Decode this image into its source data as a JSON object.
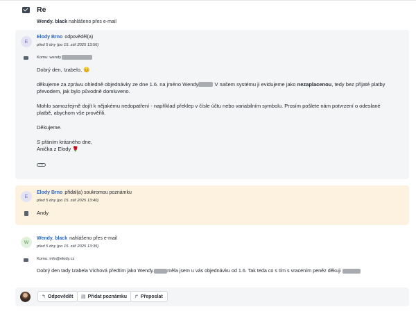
{
  "header": {
    "title": "Re",
    "icon": "envelope-icon"
  },
  "reported_line": {
    "sender": "Wendy. black",
    "text": "nahlášeno přes e-mail"
  },
  "messages": [
    {
      "author": "Elody Brno",
      "action": "odpověděl(a)",
      "time": "před 5 dny (po 15. zář 2025 13:56)",
      "avatar_letter": "E",
      "to_label": "Komu: wendy",
      "greeting": "Dobrý den, Izabelo, 😊",
      "p1_a": "děkujeme za zprávu ohledně objednávky ze dne 1.6. na jméno Wendy",
      "p1_b": " V našem systému ji evidujeme jako ",
      "p1_bold": "nezaplacenou",
      "p1_c": ", tedy bez přijaté platby převodem, jak bylo původně domluveno.",
      "p2": "Mohlo samozřejmě dojít k nějakému nedopatření - například překlep v čísle účtu nebo variabilním symbolu. Prosím pošlete nám potvrzení o odeslané platbě, abychom vše prověřili.",
      "thanks": "Děkujeme.",
      "closing": "S přáním krásného dne,",
      "signature": "Anička z Elody 🌹"
    },
    {
      "author": "Elody Brno",
      "action": "přidal(a) soukromou poznámku",
      "time": "před 5 dny (po 15. zář 2025 13:40)",
      "avatar_letter": "E",
      "note": "Andy"
    },
    {
      "author": "Wendy. black",
      "action": "nahlášeno přes e-mail",
      "time": "před 5 dny (po 15. zář 2025 13:35)",
      "avatar_letter": "W",
      "to_label": "Komu: info@elody.cz",
      "text_a": "Dobrý den tady Izabela Víchová předtím jako Wendy.",
      "text_b": "měla jsem u vás objednávku od 1.6. Tak teda co s tím s vracením peněz děkuji"
    }
  ],
  "actions": {
    "reply": "Odpovědět",
    "add_note": "Přidat poznámku",
    "forward": "Přeposlat"
  }
}
